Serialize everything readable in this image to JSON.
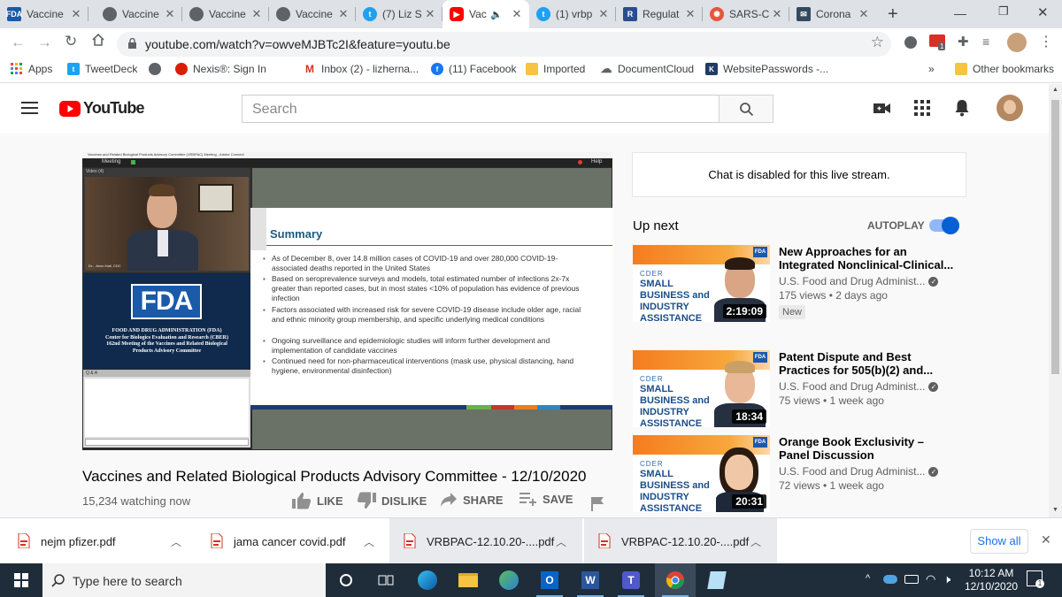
{
  "browser": {
    "tabs": [
      {
        "title": "Vaccine",
        "favicon": "fda-favicon",
        "active": false
      },
      {
        "title": "Vaccine",
        "favicon": "globe-favicon",
        "active": false
      },
      {
        "title": "Vaccine",
        "favicon": "globe-favicon",
        "active": false
      },
      {
        "title": "Vaccine",
        "favicon": "globe-favicon",
        "active": false
      },
      {
        "title": "(7) Liz S",
        "favicon": "twitter-favicon",
        "active": false
      },
      {
        "title": "Vac",
        "favicon": "youtube-favicon",
        "active": true
      },
      {
        "title": "(1) vrbp",
        "favicon": "twitter-favicon",
        "active": false
      },
      {
        "title": "Regulat",
        "favicon": "r-favicon",
        "active": false
      },
      {
        "title": "SARS-C",
        "favicon": "virus-favicon",
        "active": false
      },
      {
        "title": "Corona",
        "favicon": "envelope-favicon",
        "active": false
      }
    ],
    "url": "youtube.com/watch?v=owveMJBTc2I&feature=youtu.be",
    "bookmarks": [
      {
        "label": "Apps",
        "icon": "apps-grid-icon"
      },
      {
        "label": "TweetDeck",
        "icon": "tweetdeck-icon"
      },
      {
        "label": "",
        "icon": "globe-icon"
      },
      {
        "label": "Nexis®: Sign In",
        "icon": "nexis-icon"
      },
      {
        "label": "Inbox (2) - lizherna...",
        "icon": "gmail-icon"
      },
      {
        "label": "(11) Facebook",
        "icon": "facebook-icon"
      },
      {
        "label": "Imported",
        "icon": "folder-icon"
      },
      {
        "label": "DocumentCloud",
        "icon": "cloud-icon"
      },
      {
        "label": "WebsitePasswords -...",
        "icon": "k-icon"
      }
    ],
    "bookmarks_more": "»",
    "other_bookmarks": "Other bookmarks",
    "extension_badge": "1"
  },
  "youtube": {
    "logo": "YouTube",
    "search_placeholder": "Search",
    "player": {
      "window_title": "Vaccines and Related Biological Products Advisory Committee (VRBPAC) Meeting - Adobe Connect",
      "menu_label": "Meeting",
      "help_label": "Help",
      "video_pod_label": "Video (4)",
      "speaker_caption": "Dr... Anon Hall, CDC",
      "fda_logo": "FDA",
      "org_lines": [
        "FOOD AND DRUG ADMINISTRATION (FDA)",
        "Center for Biologics Evaluation and Research (CBER)",
        "162nd Meeting of the Vaccines and Related Biological",
        "Products Advisory Committee"
      ],
      "qa_label": "Q & A",
      "slide_title": "Summary",
      "slide_bullets": [
        "As of December 8, over 14.8 million cases of COVID-19 and over 280,000 COVID-19-associated deaths reported in the United States",
        "Based on seroprevalence surveys and models, total estimated number of infections 2x-7x greater than reported cases, but in most states <10% of population has evidence of previous infection",
        "Factors associated with increased risk for severe COVID-19 disease include older age, racial and ethnic minority group membership, and specific underlying medical conditions",
        "Ongoing surveillance and epidemiologic studies will inform further development and implementation of candidate vaccines",
        "Continued need for non-pharmaceutical interventions (mask use, physical distancing, hand hygiene, environmental disinfection)"
      ]
    },
    "video_title": "Vaccines and Related Biological Products Advisory Committee - 12/10/2020",
    "watching": "15,234 watching now",
    "actions": {
      "like": "LIKE",
      "dislike": "DISLIKE",
      "share": "SHARE",
      "save": "SAVE"
    },
    "chat_disabled": "Chat is disabled for this live stream.",
    "up_next": "Up next",
    "autoplay": "AUTOPLAY",
    "autoplay_on": true,
    "thumb_text": {
      "cder": "CDER",
      "sb": "SMALL BUSINESS and INDUSTRY ASSISTANCE",
      "fda": "FDA"
    },
    "recommendations": [
      {
        "title": "New Approaches for an Integrated Nonclinical-Clinical...",
        "channel": "U.S. Food and Drug Administ...",
        "meta": "175 views • 2 days ago",
        "duration": "2:19:09",
        "badge": "New"
      },
      {
        "title": "Patent Dispute and Best Practices for 505(b)(2) and...",
        "channel": "U.S. Food and Drug Administ...",
        "meta": "75 views • 1 week ago",
        "duration": "18:34",
        "badge": ""
      },
      {
        "title": "Orange Book Exclusivity – Panel Discussion",
        "channel": "U.S. Food and Drug Administ...",
        "meta": "72 views • 1 week ago",
        "duration": "20:31",
        "badge": ""
      }
    ]
  },
  "downloads": {
    "items": [
      "nejm pfizer.pdf",
      "jama cancer covid.pdf",
      "VRBPAC-12.10.20-....pdf",
      "VRBPAC-12.10.20-....pdf"
    ],
    "show_all": "Show all"
  },
  "taskbar": {
    "search_placeholder": "Type here to search",
    "time": "10:12 AM",
    "date": "12/10/2020",
    "notification_count": "1"
  }
}
